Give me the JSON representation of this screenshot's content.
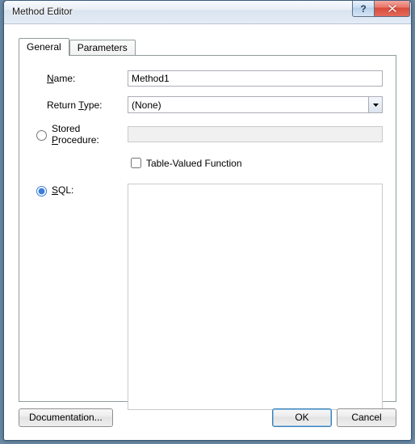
{
  "window": {
    "title": "Method Editor"
  },
  "tabs": {
    "general": "General",
    "parameters": "Parameters"
  },
  "labels": {
    "name_pre": "",
    "name_u": "N",
    "name_post": "ame:",
    "return_pre": "Return ",
    "return_u": "T",
    "return_post": "ype:",
    "stored_pre": "Stored ",
    "stored_u": "P",
    "stored_post": "rocedure:",
    "tvf": "Table-Valued Function",
    "sql_u": "S",
    "sql_post": "QL:"
  },
  "fields": {
    "name_value": "Method1",
    "return_type_value": "(None)",
    "stored_procedure_value": "",
    "tvf_checked": false,
    "sql_selected": true,
    "sql_value": ""
  },
  "buttons": {
    "documentation_u": "D",
    "documentation_post": "ocumentation...",
    "ok": "OK",
    "cancel": "Cancel"
  }
}
